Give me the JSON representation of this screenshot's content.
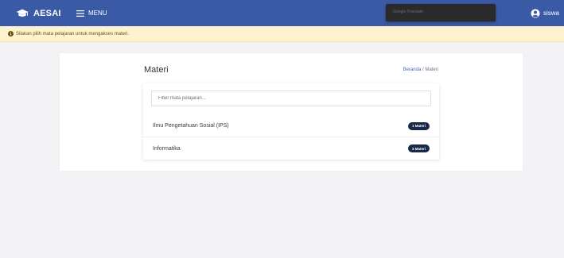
{
  "header": {
    "brand": "AESAI",
    "menu_label": "MENU",
    "tooltip_text": "Google Translate",
    "user_name": "siswa",
    "bg_color": "#3b5aa6"
  },
  "alert": {
    "message": "Silakan pilih mata pelajaran untuk mengakses materi.",
    "bg_color": "#fdf3cf"
  },
  "page": {
    "title": "Materi",
    "breadcrumb": {
      "home": "Beranda",
      "separator": " / ",
      "current": "Materi"
    },
    "filter_placeholder": "Filter mata pelajaran...",
    "subjects": [
      {
        "name": "Ilmu Pengetahuan Sosial (IPS)",
        "badge": "1 Materi"
      },
      {
        "name": "Informatika",
        "badge": "3 Materi"
      }
    ],
    "badge_color": "#19294a"
  }
}
